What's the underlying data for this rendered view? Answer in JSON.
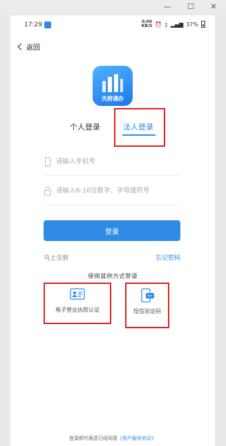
{
  "status_bar": {
    "time": "17:29",
    "net_speed": "0.00",
    "net_unit": "KB/S",
    "battery": "37%"
  },
  "nav": {
    "back_label": "返回"
  },
  "logo": {
    "text": "天府通办"
  },
  "tabs": [
    {
      "label": "个人登录",
      "active": false
    },
    {
      "label": "法人登录",
      "active": true
    }
  ],
  "form": {
    "phone_placeholder": "请输入手机号",
    "password_placeholder": "请输入6-16位数字、字母或符号",
    "login_label": "登录"
  },
  "links": {
    "register": "马上注册",
    "forgot": "忘记密码"
  },
  "other_methods": {
    "title": "使用其他方式登录",
    "options": [
      {
        "label": "电子营业执照认证",
        "icon": "license-card-icon"
      },
      {
        "label": "短信验证码",
        "icon": "sms-phone-icon"
      }
    ]
  },
  "footer": {
    "prefix": "登录即代表您已经同意",
    "agreement": "《用户服务协议》"
  },
  "colors": {
    "accent": "#2f8be6",
    "highlight": "#e02020"
  }
}
